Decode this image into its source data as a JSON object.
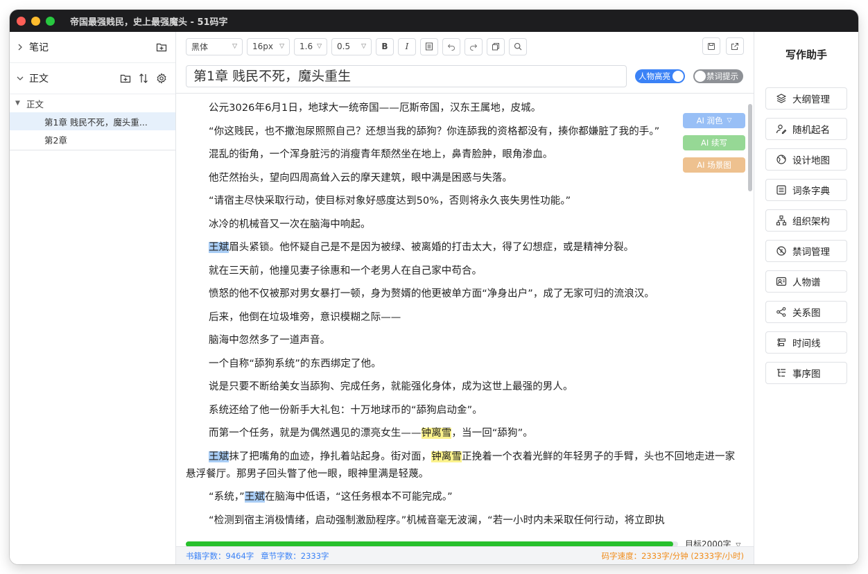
{
  "window": {
    "title": "帝国最强贱民，史上最强魔头 - 51码字"
  },
  "sidebar": {
    "notes_label": "笔记",
    "body_label": "正文",
    "tree": {
      "folder_label": "正文",
      "chapters": [
        "第1章 贱民不死，魔头重...",
        "第2章"
      ]
    }
  },
  "toolbar": {
    "font_family": "黑体",
    "font_size": "16px",
    "line_height": "1.6",
    "letter_spacing": "0.5",
    "bold_label": "B",
    "italic_label": "I"
  },
  "editor": {
    "chapter_title": "第1章 贱民不死，魔头重生",
    "toggle_character_highlight": "人物高亮",
    "toggle_banned_words": "禁词提示",
    "ai_polish": "AI 润色",
    "ai_continue": "AI 续写",
    "ai_scene": "AI 场景图",
    "paragraphs": [
      [
        "公元3026年6月1日，地球大一统帝国——厄斯帝国，汉东王属地，皮城。"
      ],
      [
        "“你这贱民，也不撒泡尿照照自己？还想当我的舔狗？你连舔我的资格都没有，揍你都嫌脏了我的手。”"
      ],
      [
        "混乱的街角，一个浑身脏污的消瘦青年颓然坐在地上，鼻青脸肿，眼角渗血。"
      ],
      [
        "他茫然抬头，望向四周高耸入云的摩天建筑，眼中满是困惑与失落。"
      ],
      [
        "“请宿主尽快采取行动，使目标对象好感度达到50%，否则将永久丧失男性功能。”"
      ],
      [
        "冰冷的机械音又一次在脑海中响起。"
      ],
      [
        "",
        "王斌",
        "眉头紧锁。他怀疑自己是不是因为被绿、被离婚的打击太大，得了幻想症，或是精神分裂。"
      ],
      [
        "就在三天前，他撞见妻子徐惠和一个老男人在自己家中苟合。"
      ],
      [
        "愤怒的他不仅被那对男女暴打一顿，身为赘婿的他更被单方面“净身出户”，成了无家可归的流浪汉。"
      ],
      [
        "后来，他倒在垃圾堆旁，意识模糊之际——"
      ],
      [
        "脑海中忽然多了一道声音。"
      ],
      [
        "一个自称“舔狗系统”的东西绑定了他。"
      ],
      [
        "说是只要不断给美女当舔狗、完成任务，就能强化身体，成为这世上最强的男人。"
      ],
      [
        "系统还给了他一份新手大礼包：十万地球币的“舔狗启动金”。"
      ],
      [
        "而第一个任务，就是为偶然遇见的漂亮女生——",
        "钟离雪",
        "，当一回“舔狗”。"
      ],
      [
        "",
        "王斌",
        "抹了把嘴角的血迹，挣扎着站起身。街对面，",
        "钟离雪",
        "正挽着一个衣着光鲜的年轻男子的手臂，头也不回地走进一家悬浮餐厅。那男子回头瞥了他一眼，眼神里满是轻蔑。"
      ],
      [
        "“系统，”",
        "王斌",
        "在脑海中低语，“这任务根本不可能完成。”"
      ],
      [
        "“检测到宿主消极情绪，启动强制激励程序。”机械音毫无波澜，“若一小时内未采取任何行动，将立即执"
      ]
    ]
  },
  "progress": {
    "goal_label": "目标2000字",
    "fraction": 0.99
  },
  "status": {
    "book_words": "书籍字数：9464字",
    "chapter_words": "章节字数：2333字",
    "speed": "码字速度：2333字/分钟 (2333字/小时)"
  },
  "assistant": {
    "title": "写作助手",
    "tools": [
      {
        "label": "大纲管理",
        "icon": "layers-icon"
      },
      {
        "label": "随机起名",
        "icon": "person-edit-icon"
      },
      {
        "label": "设计地图",
        "icon": "globe-icon"
      },
      {
        "label": "词条字典",
        "icon": "list-icon"
      },
      {
        "label": "组织架构",
        "icon": "org-chart-icon"
      },
      {
        "label": "禁词管理",
        "icon": "forbidden-icon"
      },
      {
        "label": "人物谱",
        "icon": "portrait-icon"
      },
      {
        "label": "关系图",
        "icon": "share-icon"
      },
      {
        "label": "时间线",
        "icon": "timeline-icon"
      },
      {
        "label": "事序图",
        "icon": "sequence-icon"
      }
    ]
  },
  "colors": {
    "accent": "#3b82f6",
    "highlight_name": "#a9cdf5",
    "highlight_other": "#fbf28c",
    "progress": "#27c02c",
    "speed": "#f08c1a"
  }
}
